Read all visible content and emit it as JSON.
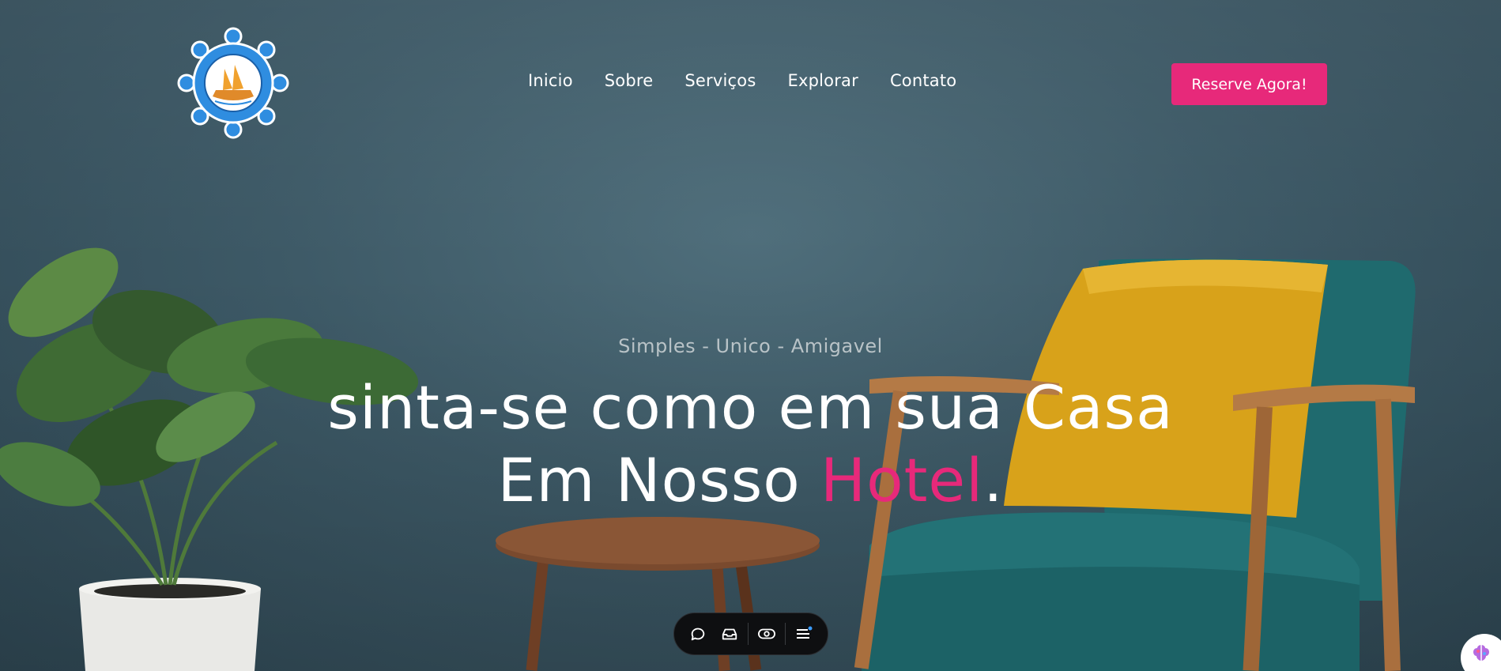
{
  "nav": {
    "logo_alt": "Hotel Veleiro",
    "items": [
      {
        "label": "Inicio"
      },
      {
        "label": "Sobre"
      },
      {
        "label": "Serviços"
      },
      {
        "label": "Explorar"
      },
      {
        "label": "Contato"
      }
    ],
    "cta_label": "Reserve Agora!"
  },
  "hero": {
    "tagline": "Simples - Unico - Amigavel",
    "headline_line1": "sinta-se como em sua Casa",
    "headline_line2_prefix": "Em Nosso ",
    "headline_line2_accent": "Hotel",
    "headline_line2_suffix": "."
  },
  "toolbar": {
    "icons": [
      "chat-icon",
      "inbox-icon",
      "eye-icon",
      "menu-icon"
    ]
  },
  "corner_widget": {
    "icon": "brain-icon"
  },
  "colors": {
    "accent": "#e7297a",
    "wall": "#3d5966",
    "chair": "#1f6a6e",
    "pillow": "#d8a21a"
  }
}
